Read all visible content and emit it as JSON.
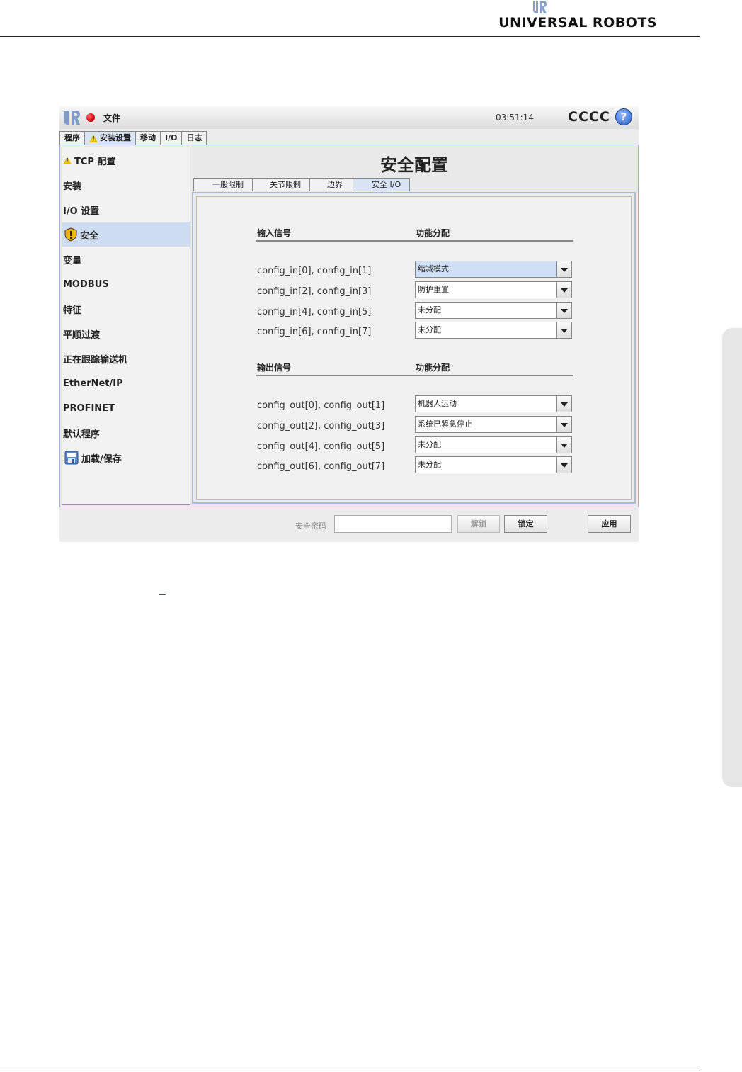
{
  "document": {
    "brand": "UNIVERSAL ROBOTS"
  },
  "titlebar": {
    "file_menu": "文件",
    "clock": "03:51:14",
    "robot_name": "CCCC",
    "help": "?"
  },
  "main_tabs": [
    {
      "label": "程序",
      "warning": false,
      "active": false
    },
    {
      "label": "安装设置",
      "warning": true,
      "active": true
    },
    {
      "label": "移动",
      "warning": false,
      "active": false
    },
    {
      "label": "I/O",
      "warning": false,
      "active": false
    },
    {
      "label": "日志",
      "warning": false,
      "active": false
    }
  ],
  "sidebar": {
    "items": [
      {
        "label": "TCP 配置",
        "icon": "warning-icon"
      },
      {
        "label": "安装",
        "icon": ""
      },
      {
        "label": "I/O 设置",
        "icon": ""
      },
      {
        "label": "安全",
        "icon": "shield-icon",
        "active": true
      },
      {
        "label": "变量",
        "icon": ""
      },
      {
        "label": "MODBUS",
        "icon": ""
      },
      {
        "label": "特征",
        "icon": ""
      },
      {
        "label": "平顺过渡",
        "icon": ""
      },
      {
        "label": "正在跟踪输送机",
        "icon": ""
      },
      {
        "label": "EtherNet/IP",
        "icon": ""
      },
      {
        "label": "PROFINET",
        "icon": ""
      },
      {
        "label": "默认程序",
        "icon": ""
      },
      {
        "label": "加载/保存",
        "icon": "save-icon"
      }
    ]
  },
  "page_title": "安全配置",
  "sub_tabs": [
    {
      "label": "一般限制",
      "active": false
    },
    {
      "label": "关节限制",
      "active": false
    },
    {
      "label": "边界",
      "active": false
    },
    {
      "label": "安全 I/O",
      "active": true
    }
  ],
  "inputs": {
    "header_signal": "输入信号",
    "header_function": "功能分配",
    "rows": [
      {
        "signal": "config_in[0], config_in[1]",
        "function": "缩减模式"
      },
      {
        "signal": "config_in[2], config_in[3]",
        "function": "防护重置"
      },
      {
        "signal": "config_in[4], config_in[5]",
        "function": "未分配"
      },
      {
        "signal": "config_in[6], config_in[7]",
        "function": "未分配"
      }
    ]
  },
  "outputs": {
    "header_signal": "输出信号",
    "header_function": "功能分配",
    "rows": [
      {
        "signal": "config_out[0], config_out[1]",
        "function": "机器人运动"
      },
      {
        "signal": "config_out[2], config_out[3]",
        "function": "系统已紧急停止"
      },
      {
        "signal": "config_out[4], config_out[5]",
        "function": "未分配"
      },
      {
        "signal": "config_out[6], config_out[7]",
        "function": "未分配"
      }
    ]
  },
  "bottom": {
    "password_label": "安全密码",
    "password_value": "",
    "unlock": "解锁",
    "lock": "锁定",
    "apply": "应用"
  },
  "colors": {
    "active_tab": "#d8e4f4",
    "sidebar_active": "#cddcf0",
    "accent_blue": "#2b61c9"
  }
}
